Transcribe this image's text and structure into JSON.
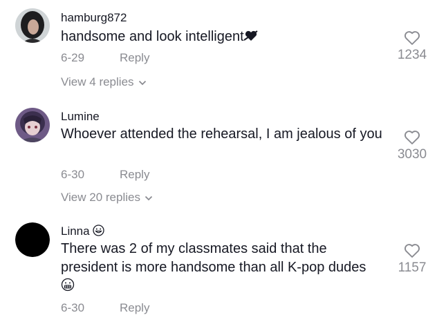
{
  "comments": [
    {
      "username": "hamburg872",
      "text": "handsome and look intelligent",
      "date": "6-29",
      "reply_label": "Reply",
      "likes": "1234",
      "view_replies": "View 4 replies",
      "avatar_icon": "woman-portrait-avatar",
      "inline_emoji": "heart-arrow-emoji"
    },
    {
      "username": "Lumine",
      "text": "Whoever attended the rehearsal, I am jealous of you",
      "date": "6-30",
      "reply_label": "Reply",
      "likes": "3030",
      "view_replies": "View 20 replies",
      "avatar_icon": "anime-character-avatar"
    },
    {
      "username": "Linna",
      "text": "There was 2 of my classmates said that the president is more handsome than all K-pop dudes",
      "date": "6-30",
      "reply_label": "Reply",
      "likes": "1157",
      "avatar_icon": "black-circle-avatar",
      "name_emoji": "grinning-face-emoji",
      "trailing_emoji": "grimacing-face-emoji"
    }
  ],
  "colors": {
    "text": "#161823",
    "muted": "#8a8b91"
  }
}
